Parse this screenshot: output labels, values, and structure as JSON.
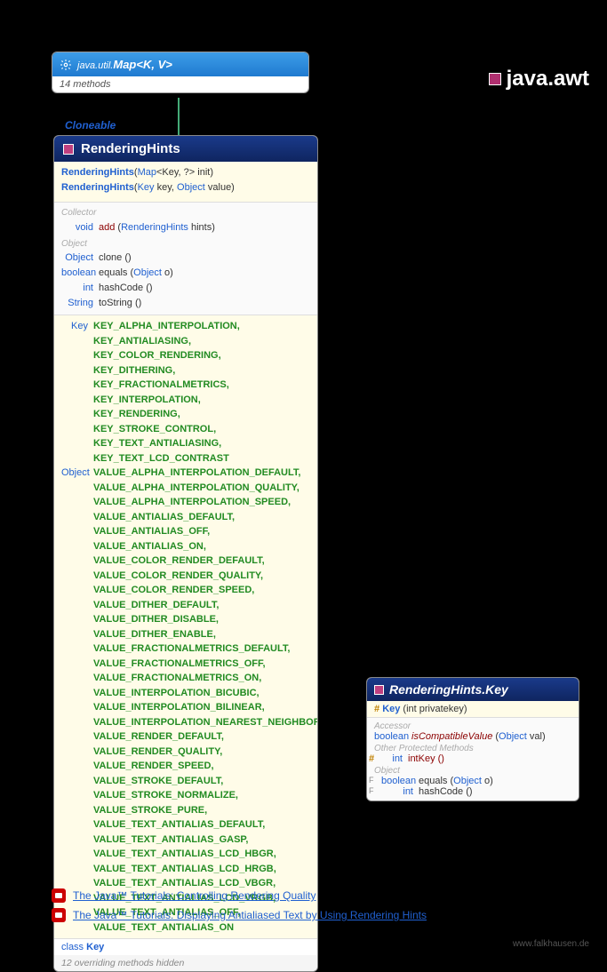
{
  "package": {
    "name": "java.awt"
  },
  "map": {
    "pkg": "java.util.",
    "class_name": "Map",
    "type_params": "<K, V>",
    "methods_count": "14 methods"
  },
  "cloneable": "Cloneable",
  "rh": {
    "title": "RenderingHints",
    "ctors": [
      {
        "name": "RenderingHints",
        "params_pre": "(",
        "ptype1": "Map",
        "pgen": "<Key, ?>",
        "pname1": " init)",
        "full": ""
      },
      {
        "name": "RenderingHints",
        "params_pre": "(",
        "ptype1": "Key",
        "pname1": " key, ",
        "ptype2": "Object",
        "pname2": " value)"
      }
    ],
    "sections": {
      "collector": "Collector",
      "object": "Object"
    },
    "methods": {
      "add": {
        "ret": "void",
        "name": "add",
        "paren_open": " (",
        "ptype": "RenderingHints",
        "pname": " hints)"
      },
      "clone": {
        "ret": "Object",
        "name": "clone ()"
      },
      "equals": {
        "ret": "boolean",
        "name": "equals",
        "paren_open": " (",
        "ptype": "Object",
        "pname": " o)"
      },
      "hashCode": {
        "ret": "int",
        "name": "hashCode ()"
      },
      "toString": {
        "ret": "String",
        "name": "toString ()"
      }
    },
    "keys_type": "Key",
    "keys": [
      "KEY_ALPHA_INTERPOLATION,",
      "KEY_ANTIALIASING,",
      "KEY_COLOR_RENDERING,",
      "KEY_DITHERING,",
      "KEY_FRACTIONALMETRICS,",
      "KEY_INTERPOLATION,",
      "KEY_RENDERING,",
      "KEY_STROKE_CONTROL,",
      "KEY_TEXT_ANTIALIASING,",
      "KEY_TEXT_LCD_CONTRAST"
    ],
    "values_type": "Object",
    "values": [
      "VALUE_ALPHA_INTERPOLATION_DEFAULT,",
      "VALUE_ALPHA_INTERPOLATION_QUALITY,",
      "VALUE_ALPHA_INTERPOLATION_SPEED,",
      "VALUE_ANTIALIAS_DEFAULT,",
      "VALUE_ANTIALIAS_OFF,",
      "VALUE_ANTIALIAS_ON,",
      "VALUE_COLOR_RENDER_DEFAULT,",
      "VALUE_COLOR_RENDER_QUALITY,",
      "VALUE_COLOR_RENDER_SPEED,",
      "VALUE_DITHER_DEFAULT,",
      "VALUE_DITHER_DISABLE,",
      "VALUE_DITHER_ENABLE,",
      "VALUE_FRACTIONALMETRICS_DEFAULT,",
      "VALUE_FRACTIONALMETRICS_OFF,",
      "VALUE_FRACTIONALMETRICS_ON,",
      "VALUE_INTERPOLATION_BICUBIC,",
      "VALUE_INTERPOLATION_BILINEAR,",
      "VALUE_INTERPOLATION_NEAREST_NEIGHBOR,",
      "VALUE_RENDER_DEFAULT,",
      "VALUE_RENDER_QUALITY,",
      "VALUE_RENDER_SPEED,",
      "VALUE_STROKE_DEFAULT,",
      "VALUE_STROKE_NORMALIZE,",
      "VALUE_STROKE_PURE,",
      "VALUE_TEXT_ANTIALIAS_DEFAULT,",
      "VALUE_TEXT_ANTIALIAS_GASP,",
      "VALUE_TEXT_ANTIALIAS_LCD_HBGR,",
      "VALUE_TEXT_ANTIALIAS_LCD_HRGB,",
      "VALUE_TEXT_ANTIALIAS_LCD_VBGR,",
      "VALUE_TEXT_ANTIALIAS_LCD_VRGB,",
      "VALUE_TEXT_ANTIALIAS_OFF,",
      "VALUE_TEXT_ANTIALIAS_ON"
    ],
    "inner_class_kw": "class",
    "inner_class": "Key",
    "footer": "12 overriding methods hidden"
  },
  "key": {
    "title": "RenderingHints.Key",
    "ctor": {
      "hash": "#",
      "name": "Key",
      "params": " (int privatekey)"
    },
    "sections": {
      "accessor": "Accessor",
      "other_prot": "Other Protected Methods",
      "object": "Object"
    },
    "isCompat": {
      "ret": "boolean",
      "name": "isCompatibleValue",
      "paren_open": " (",
      "ptype": "Object",
      "pname": " val)"
    },
    "intKey": {
      "hash": "#",
      "ret": "int",
      "name": "intKey ()"
    },
    "equals": {
      "mark": "F",
      "ret": "boolean",
      "name": "equals",
      "paren_open": " (",
      "ptype": "Object",
      "pname": " o)"
    },
    "hashCode": {
      "mark": "F",
      "ret": "int",
      "name": "hashCode ()"
    }
  },
  "links": [
    "The Java™ Tutorials: Controlling Rendering Quality",
    "The Java™ Tutorials: Displaying Antialiased Text by Using Rendering Hints"
  ],
  "footer_url": "www.falkhausen.de"
}
